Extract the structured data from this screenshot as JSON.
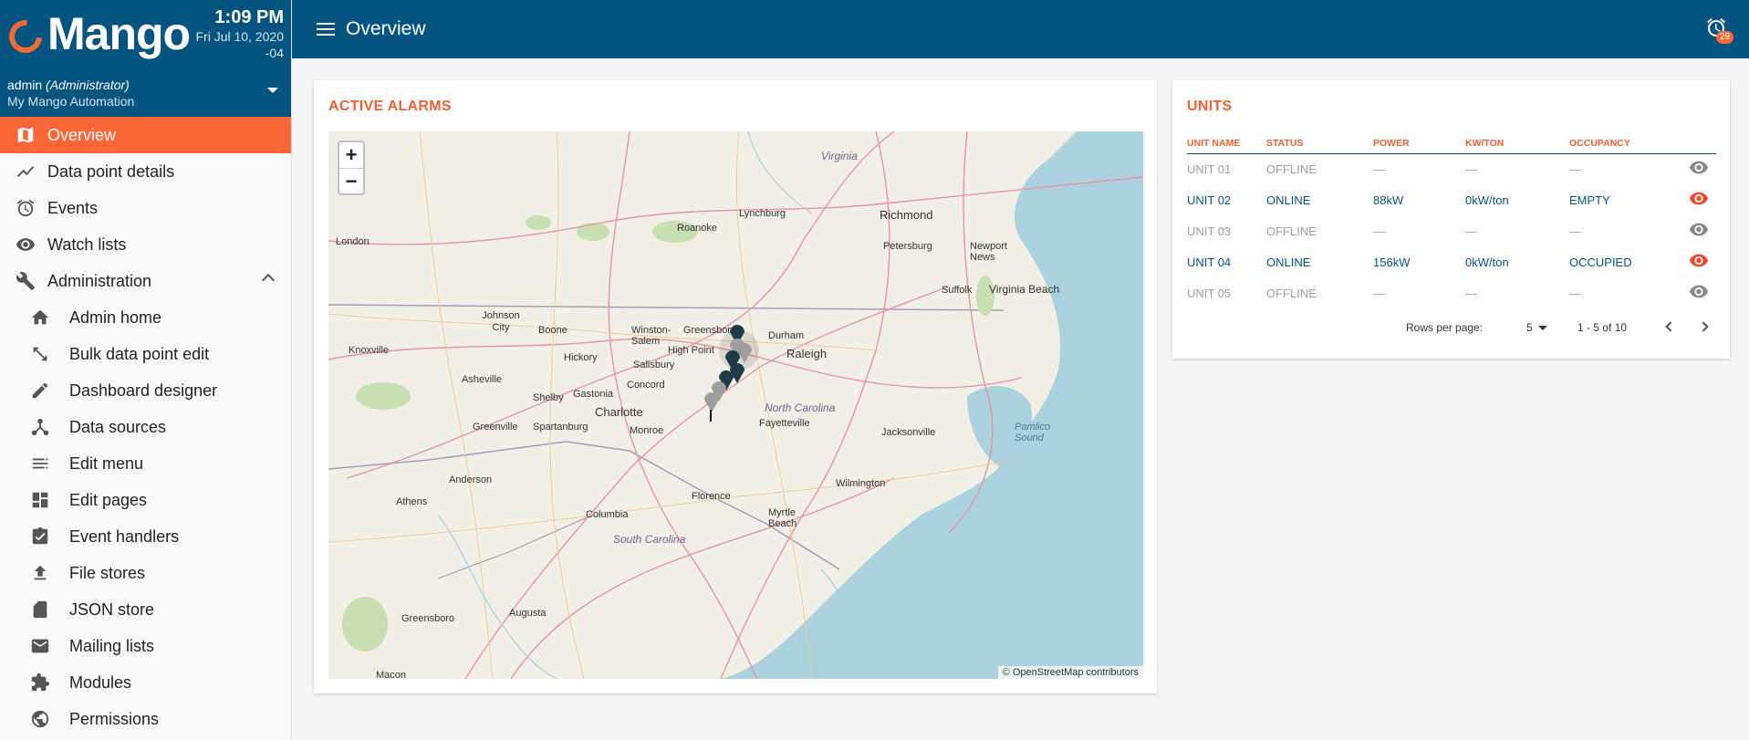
{
  "brand": {
    "name": "Mango",
    "time": "1:09 PM",
    "date": "Fri Jul 10, 2020",
    "tz": "-04"
  },
  "user": {
    "name": "admin",
    "role": "(Administrator)",
    "org": "My Mango Automation"
  },
  "header": {
    "title": "Overview",
    "alarm_count": "29"
  },
  "menu": {
    "main": [
      {
        "label": "Overview",
        "icon": "map-icon"
      },
      {
        "label": "Data point details",
        "icon": "trending-icon"
      },
      {
        "label": "Events",
        "icon": "alarm-clock-icon"
      },
      {
        "label": "Watch lists",
        "icon": "eye-icon"
      },
      {
        "label": "Administration",
        "icon": "wrench-icon"
      }
    ],
    "admin": [
      {
        "label": "Admin home",
        "icon": "home-icon"
      },
      {
        "label": "Bulk data point edit",
        "icon": "arrows-icon"
      },
      {
        "label": "Dashboard designer",
        "icon": "pencil-icon"
      },
      {
        "label": "Data sources",
        "icon": "hub-icon"
      },
      {
        "label": "Edit menu",
        "icon": "list-icon"
      },
      {
        "label": "Edit pages",
        "icon": "dashboard-icon"
      },
      {
        "label": "Event handlers",
        "icon": "clipboard-check-icon"
      },
      {
        "label": "File stores",
        "icon": "upload-icon"
      },
      {
        "label": "JSON store",
        "icon": "sd-card-icon"
      },
      {
        "label": "Mailing lists",
        "icon": "mail-icon"
      },
      {
        "label": "Modules",
        "icon": "puzzle-icon"
      },
      {
        "label": "Permissions",
        "icon": "globe-icon"
      }
    ]
  },
  "alarms": {
    "title": "ACTIVE ALARMS",
    "zoom_in": "+",
    "zoom_out": "−",
    "attribution": "© OpenStreetMap contributors"
  },
  "map_labels": [
    "Virginia",
    "Lynchburg",
    "Richmond",
    "Roanoke",
    "Petersburg",
    "Newport News",
    "London",
    "Suffolk",
    "Virginia Beach",
    "Johnson City",
    "Boone",
    "Winston-Salem",
    "Greensboro",
    "Durham",
    "Raleigh",
    "Knoxville",
    "Hickory",
    "High Point",
    "Salisbury",
    "Asheville",
    "Concord",
    "Shelby",
    "Gastonia",
    "Charlotte",
    "North Carolina",
    "Fayetteville",
    "Spartanburg",
    "Monroe",
    "Greenville",
    "Jacksonville",
    "Pamlico Sound",
    "Anderson",
    "Wilmington",
    "Florence",
    "Athens",
    "Columbia",
    "Myrtle Beach",
    "South Carolina",
    "Greensboro",
    "Augusta",
    "Macon"
  ],
  "units": {
    "title": "UNITS",
    "columns": [
      "UNIT NAME",
      "STATUS",
      "POWER",
      "KW/TON",
      "OCCUPANCY"
    ],
    "rows": [
      {
        "name": "UNIT 01",
        "status": "OFFLINE",
        "power": "—",
        "kwton": "—",
        "occupancy": "—"
      },
      {
        "name": "UNIT 02",
        "status": "ONLINE",
        "power": "88kW",
        "kwton": "0kW/ton",
        "occupancy": "EMPTY"
      },
      {
        "name": "UNIT 03",
        "status": "OFFLINE",
        "power": "—",
        "kwton": "—",
        "occupancy": "—"
      },
      {
        "name": "UNIT 04",
        "status": "ONLINE",
        "power": "156kW",
        "kwton": "0kW/ton",
        "occupancy": "OCCUPIED"
      },
      {
        "name": "UNIT 05",
        "status": "OFFLINE",
        "power": "—",
        "kwton": "—",
        "occupancy": "—"
      }
    ],
    "rows_per_page_label": "Rows per page:",
    "rows_per_page": "5",
    "range": "1 - 5 of 10"
  }
}
